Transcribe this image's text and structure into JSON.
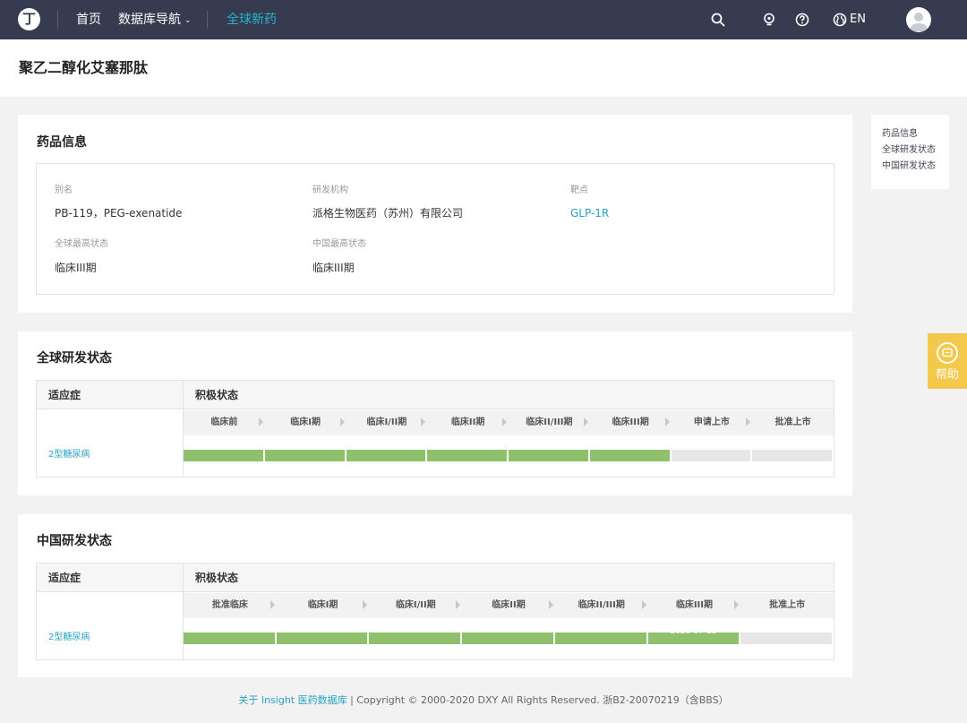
{
  "nav": {
    "logo_icon": "dxy-logo-icon",
    "home": "首页",
    "db_nav": "数据库导航",
    "new_drugs": "全球新药",
    "lang": "EN",
    "icons": [
      "search-icon",
      "bulb-icon",
      "question-icon",
      "globe-icon",
      "user-avatar-icon"
    ]
  },
  "page": {
    "title": "聚乙二醇化艾塞那肽"
  },
  "drug_info": {
    "title": "药品信息",
    "fields": [
      {
        "label": "别名",
        "value": "PB-119，PEG-exenatide"
      },
      {
        "label": "研发机构",
        "value": "派格生物医药（苏州）有限公司"
      },
      {
        "label": "靶点",
        "value": "GLP-1R"
      },
      {
        "label": "全球最高状态",
        "value": "临床III期"
      },
      {
        "label": "中国最高状态",
        "value": "临床III期"
      }
    ]
  },
  "global_status": {
    "title": "全球研发状态",
    "col_indication": "适应症",
    "col_status": "积极状态",
    "stages": [
      "临床前",
      "临床I期",
      "临床I/II期",
      "临床II期",
      "临床II/III期",
      "临床III期",
      "申请上市",
      "批准上市"
    ],
    "rows": [
      {
        "indication": "2型糖尿病",
        "completed": 6,
        "date": ""
      }
    ]
  },
  "china_status": {
    "title": "中国研发状态",
    "col_indication": "适应症",
    "col_status": "积极状态",
    "stages": [
      "批准临床",
      "临床I期",
      "临床I/II期",
      "临床II期",
      "临床II/III期",
      "临床III期",
      "批准上市"
    ],
    "rows": [
      {
        "indication": "2型糖尿病",
        "completed": 6,
        "date": "2020-07-15"
      }
    ]
  },
  "sidenav": {
    "items": [
      "药品信息",
      "全球研发状态",
      "中国研发状态"
    ]
  },
  "help": {
    "label": "帮助",
    "icon": "chat-help-icon"
  },
  "footer": {
    "link": "关于 Insight 医药数据库",
    "text": " | Copyright © 2000-2020 DXY All Rights Reserved. 浙B2-20070219（含BBS）"
  },
  "colors": {
    "topbar": "#363b4f",
    "accent": "#27b4cf",
    "progress": "#8fc06b",
    "help": "#f3c84b"
  }
}
